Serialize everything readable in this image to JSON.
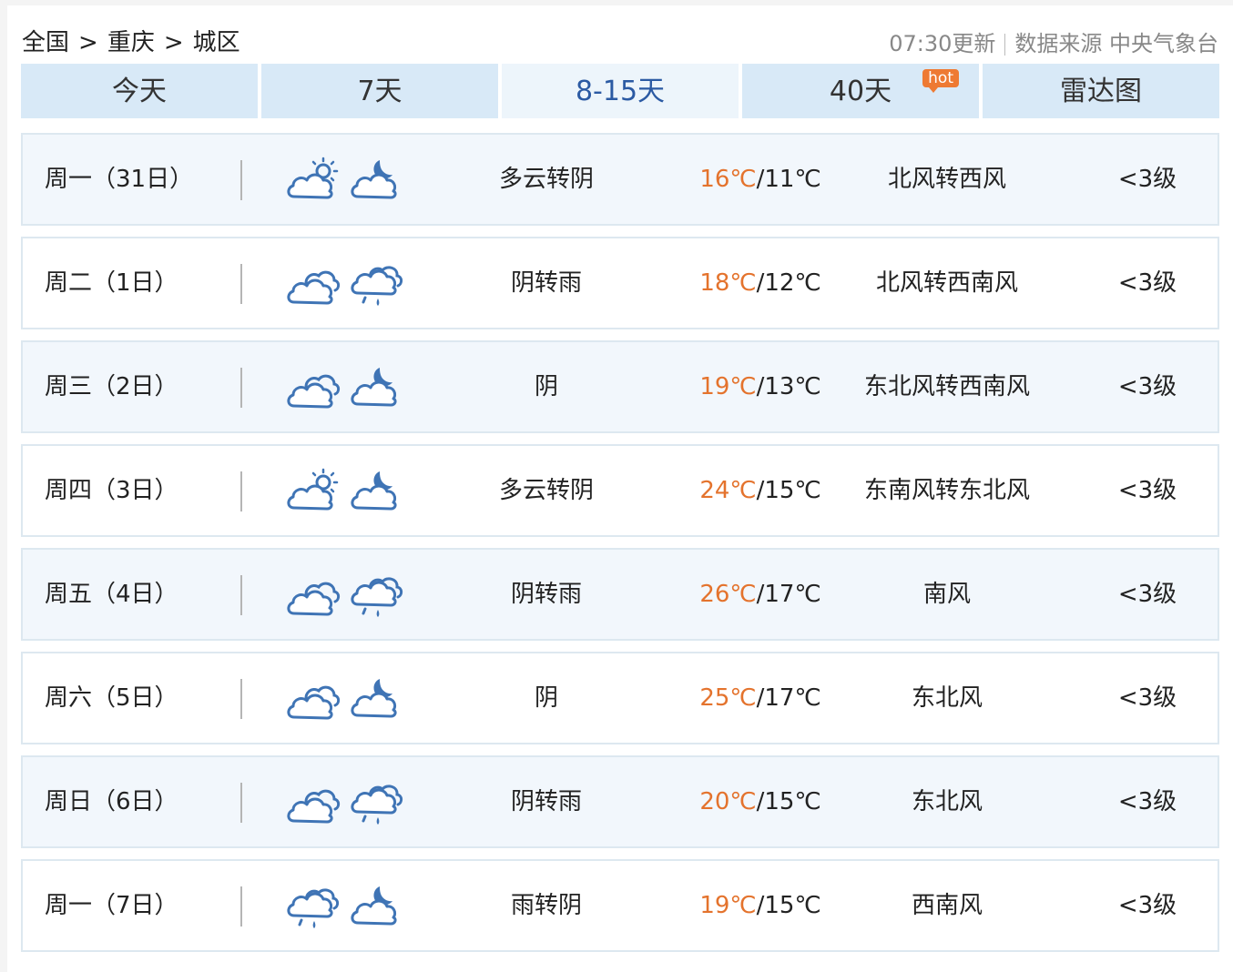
{
  "breadcrumb": {
    "items": [
      "全国",
      "重庆",
      "城区"
    ],
    "separator": ">"
  },
  "meta": {
    "updated": "07:30更新",
    "source_label": "数据来源 中央气象台"
  },
  "tabs": [
    {
      "label": "今天"
    },
    {
      "label": "7天"
    },
    {
      "label": "8-15天",
      "active": true
    },
    {
      "label": "40天",
      "badge": "hot"
    },
    {
      "label": "雷达图"
    }
  ],
  "forecast": [
    {
      "day": "周一（31日）",
      "icon_day": "partly-cloudy-sun-icon",
      "icon_night": "cloudy-moon-icon",
      "desc": "多云转阴",
      "high": "16℃",
      "low": "11℃",
      "wind": "北风转西风",
      "level": "<3级"
    },
    {
      "day": "周二（1日）",
      "icon_day": "overcast-icon",
      "icon_night": "rain-icon",
      "desc": "阴转雨",
      "high": "18℃",
      "low": "12℃",
      "wind": "北风转西南风",
      "level": "<3级"
    },
    {
      "day": "周三（2日）",
      "icon_day": "overcast-icon",
      "icon_night": "cloudy-moon-icon",
      "desc": "阴",
      "high": "19℃",
      "low": "13℃",
      "wind": "东北风转西南风",
      "level": "<3级"
    },
    {
      "day": "周四（3日）",
      "icon_day": "partly-cloudy-sun-icon",
      "icon_night": "cloudy-moon-icon",
      "desc": "多云转阴",
      "high": "24℃",
      "low": "15℃",
      "wind": "东南风转东北风",
      "level": "<3级"
    },
    {
      "day": "周五（4日）",
      "icon_day": "overcast-icon",
      "icon_night": "rain-icon",
      "desc": "阴转雨",
      "high": "26℃",
      "low": "17℃",
      "wind": "南风",
      "level": "<3级"
    },
    {
      "day": "周六（5日）",
      "icon_day": "overcast-icon",
      "icon_night": "cloudy-moon-icon",
      "desc": "阴",
      "high": "25℃",
      "low": "17℃",
      "wind": "东北风",
      "level": "<3级"
    },
    {
      "day": "周日（6日）",
      "icon_day": "overcast-icon",
      "icon_night": "rain-icon",
      "desc": "阴转雨",
      "high": "20℃",
      "low": "15℃",
      "wind": "东北风",
      "level": "<3级"
    },
    {
      "day": "周一（7日）",
      "icon_day": "rain-icon",
      "icon_night": "cloudy-moon-icon",
      "desc": "雨转阴",
      "high": "19℃",
      "low": "15℃",
      "wind": "西南风",
      "level": "<3级"
    }
  ],
  "colors": {
    "tab_bg": "#d8e9f7",
    "tab_active_bg": "#edf5fb",
    "tab_active_text": "#2b5aa3",
    "high_temp": "#e4732d",
    "icon_stroke": "#3f74b5",
    "hot_badge": "#ee7a33"
  }
}
